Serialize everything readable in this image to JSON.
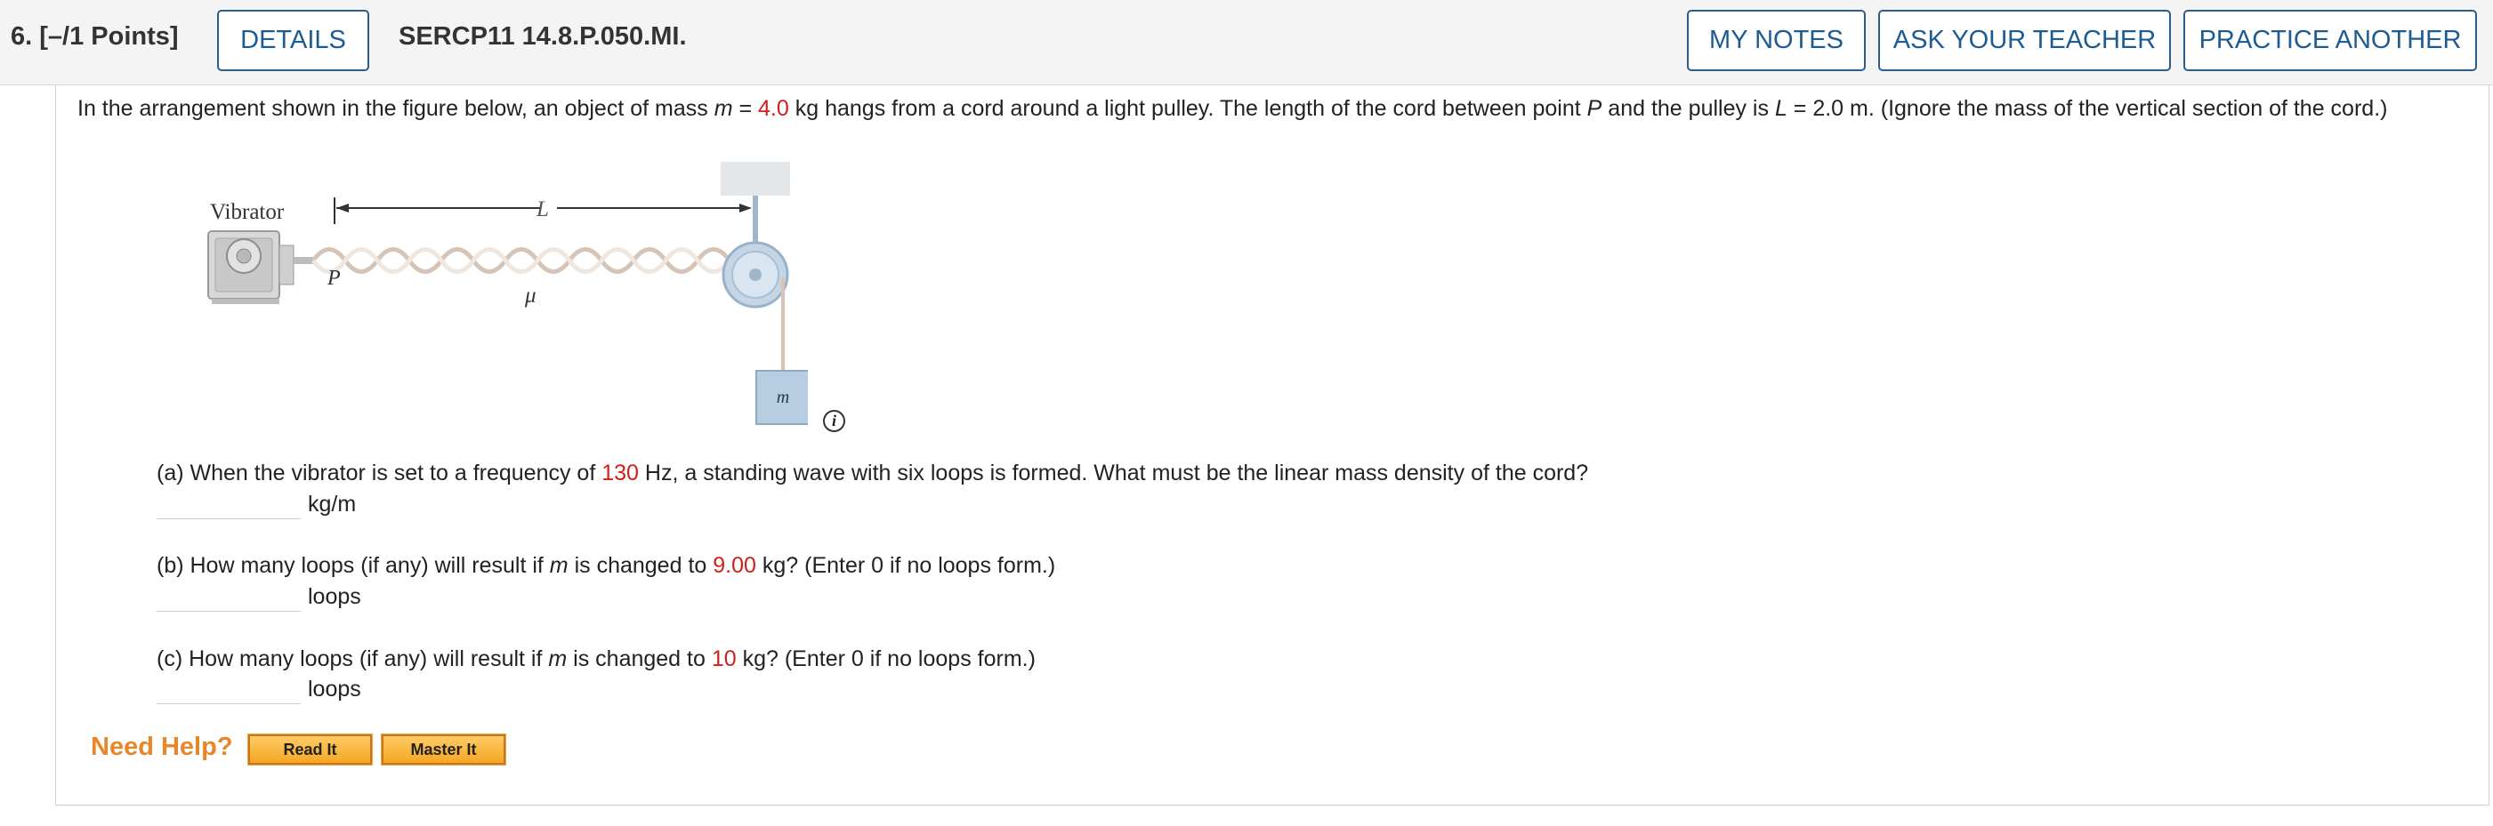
{
  "header": {
    "question_number": "6. [–/1 Points]",
    "details_label": "DETAILS",
    "question_id": "SERCP11 14.8.P.050.MI.",
    "my_notes_label": "MY NOTES",
    "ask_teacher_label": "ASK YOUR TEACHER",
    "practice_label": "PRACTICE ANOTHER"
  },
  "problem": {
    "intro_1": "In the arrangement shown in the figure below, an object of mass ",
    "intro_m": "m",
    "intro_2": " = ",
    "mass": "4.0",
    "intro_3": " kg hangs from a cord around a light pulley. The length of the cord between point ",
    "intro_P": "P",
    "intro_4": " and the pulley is ",
    "intro_L": "L",
    "intro_5": " = 2.0 m. (Ignore the mass of the vertical section of the cord.)"
  },
  "figure": {
    "vibrator_label": "Vibrator",
    "length_label": "L",
    "point_label": "P",
    "density_label": "μ",
    "mass_label": "m",
    "info_icon": "i"
  },
  "parts": {
    "a": {
      "text_1": "(a) When the vibrator is set to a frequency of ",
      "value": "130",
      "text_2": " Hz, a standing wave with six loops is formed. What must be the linear mass density of the cord?",
      "unit": "kg/m"
    },
    "b": {
      "text_1": "(b) How many loops (if any) will result if ",
      "m": "m",
      "text_2": " is changed to ",
      "value": "9.00",
      "text_3": " kg? (Enter 0 if no loops form.)",
      "unit": "loops"
    },
    "c": {
      "text_1": "(c) How many loops (if any) will result if ",
      "m": "m",
      "text_2": " is changed to ",
      "value": "10",
      "text_3": " kg? (Enter 0 if no loops form.)",
      "unit": "loops"
    }
  },
  "help": {
    "label": "Need Help?",
    "read_it": "Read It",
    "master_it": "Master It"
  },
  "colors": {
    "accent": "#1d5b93",
    "value_red": "#d0201c",
    "need_help": "#e8872a"
  }
}
